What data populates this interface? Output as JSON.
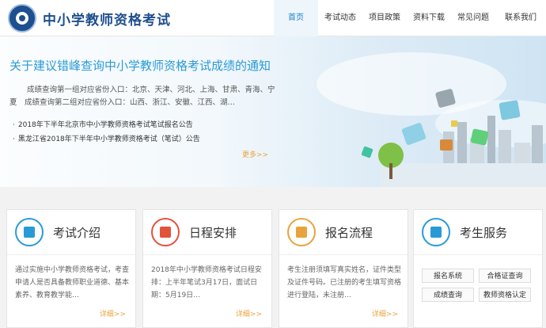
{
  "header": {
    "site_title": "中小学教师资格考试"
  },
  "nav": [
    {
      "label": "首页",
      "active": true
    },
    {
      "label": "考试动态",
      "active": false
    },
    {
      "label": "项目政策",
      "active": false
    },
    {
      "label": "资料下载",
      "active": false
    },
    {
      "label": "常见问题",
      "active": false
    },
    {
      "label": "联系我们",
      "active": false
    }
  ],
  "hero": {
    "title": "关于建议错峰查询中小学教师资格考试成绩的通知",
    "paragraph": "成绩查询第一组对应省份入口：北京、天津、河北、上海、甘肃、青海、宁夏　成绩查询第二组对应省份入口：山西、浙江、安徽、江西、湖…",
    "notices": [
      "2018年下半年北京市中小学教师资格考试笔试报名公告",
      "黑龙江省2018年下半年中小学教师资格考试（笔试）公告"
    ],
    "more": "更多>>"
  },
  "cards": [
    {
      "title": "考试介绍",
      "text": "通过实施中小学教师资格考试，考查申请人是否具备教师职业道德、基本素养、教育教学能…",
      "more": "详细>>",
      "icon": "document-icon"
    },
    {
      "title": "日程安排",
      "text": "2018年中小学教师资格考试日程安排：上半年笔试3月17日，面试日期：5月19日…",
      "more": "详细>>",
      "icon": "checkmark-icon"
    },
    {
      "title": "报名流程",
      "text": "考生注册须填写真实姓名，证件类型及证件号码。已注册的考生填写资格进行登陆，未注册…",
      "more": "详细>>",
      "icon": "id-card-icon"
    },
    {
      "title": "考生服务",
      "icon": "contacts-icon"
    }
  ],
  "services": [
    "报名系统",
    "合格证查询",
    "成绩查询",
    "教师资格认定"
  ],
  "colors": {
    "brand": "#1e4f8f",
    "accent": "#2a9ad6",
    "more": "#e8a33e"
  }
}
